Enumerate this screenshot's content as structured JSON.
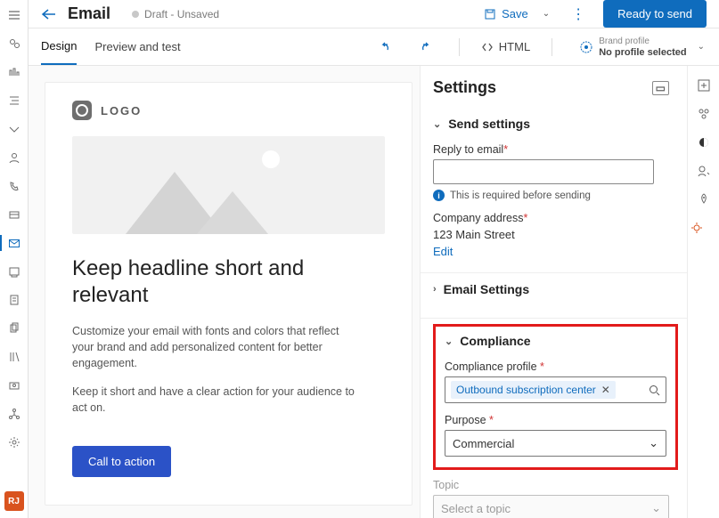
{
  "rail": {
    "avatar": "RJ"
  },
  "header": {
    "back": "←",
    "title": "Email",
    "status": "Draft - Unsaved",
    "save": "Save",
    "ready": "Ready to send"
  },
  "secondbar": {
    "tab_design": "Design",
    "tab_preview": "Preview and test",
    "html": "HTML",
    "brand_label": "Brand profile",
    "brand_value": "No profile selected"
  },
  "canvas": {
    "logo": "LOGO",
    "headline": "Keep headline short and relevant",
    "para1": "Customize your email with fonts and colors that reflect your brand and add personalized content for better engagement.",
    "para2": "Keep it short and have a clear action for your audience to act on.",
    "cta": "Call to action"
  },
  "panel": {
    "title": "Settings",
    "send_head": "Send settings",
    "reply_label": "Reply to email",
    "reply_required_msg": "This is required before sending",
    "company_label": "Company address",
    "company_value": "123 Main Street",
    "edit": "Edit",
    "email_settings_head": "Email Settings",
    "compliance_head": "Compliance",
    "compliance_profile_label": "Compliance profile",
    "compliance_profile_value": "Outbound subscription center",
    "purpose_label": "Purpose",
    "purpose_value": "Commercial",
    "topic_label": "Topic",
    "topic_placeholder": "Select a topic"
  }
}
